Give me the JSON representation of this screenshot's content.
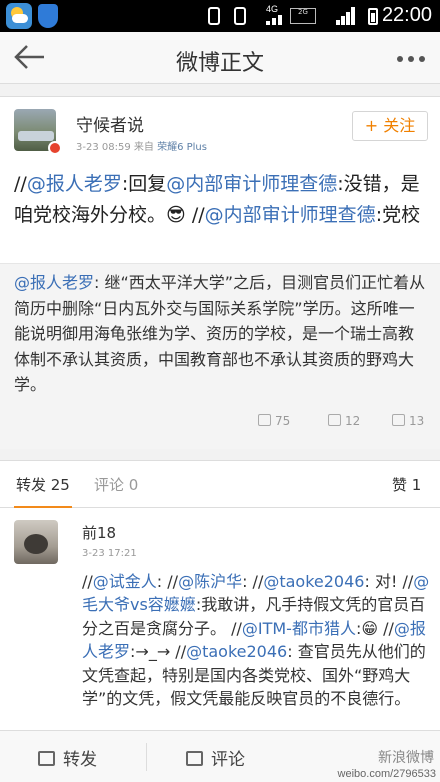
{
  "status_bar": {
    "network_label": "4G",
    "sim_label": "2G",
    "time": "22:00"
  },
  "nav": {
    "title": "微博正文",
    "back_icon": "arrow-left-icon",
    "more_icon": "more-dots-icon"
  },
  "post": {
    "username": "守候者说",
    "time": "3-23 08:59",
    "source_prefix": "来自",
    "source": "荣耀6 Plus",
    "follow_label": "+ 关注",
    "text_segments": [
      {
        "t": "//",
        "link": false
      },
      {
        "t": "@报人老罗",
        "link": true
      },
      {
        "t": ":回复",
        "link": false
      },
      {
        "t": "@内部审计师理查德",
        "link": true
      },
      {
        "t": ":没错，是咱党校海外分校。",
        "link": false
      },
      {
        "t": "😎",
        "link": false
      },
      {
        "t": " //",
        "link": false
      },
      {
        "t": "@内部审计师理查德",
        "link": true
      },
      {
        "t": ":党校",
        "link": false
      }
    ]
  },
  "repost": {
    "text_segments": [
      {
        "t": "@报人老罗",
        "link": true
      },
      {
        "t": ": 继“西太平洋大学”之后，目测官员们正忙着从简历中删除“日内瓦外交与国际关系学院”学历。这所唯一能说明御用海龟张维为学、资历的学校，是一个瑞士高教体制不承认其资质，中国教育部也不承认其资质的野鸡大学。",
        "link": false
      }
    ],
    "reposts": "75",
    "comments": "12",
    "likes": "13"
  },
  "tabs": {
    "repost_label": "转发 25",
    "comment_label": "评论 0",
    "like_label": "赞 1"
  },
  "comment": {
    "username": "前18",
    "time": "3-23 17:21",
    "text_segments": [
      {
        "t": "//",
        "link": false
      },
      {
        "t": "@试金人",
        "link": true
      },
      {
        "t": ": //",
        "link": false
      },
      {
        "t": "@陈沪华",
        "link": true
      },
      {
        "t": ": //",
        "link": false
      },
      {
        "t": "@taoke2046",
        "link": true
      },
      {
        "t": ": 对! //",
        "link": false
      },
      {
        "t": "@毛大爷vs容嬷嬷",
        "link": true
      },
      {
        "t": ":我敢讲，凡手持假文凭的官员百分之百是贪腐分子。 //",
        "link": false
      },
      {
        "t": "@ITM-都市猎人",
        "link": true
      },
      {
        "t": ":😁 //",
        "link": false
      },
      {
        "t": "@报人老罗",
        "link": true
      },
      {
        "t": ":→_→ //",
        "link": false
      },
      {
        "t": "@taoke2046",
        "link": true
      },
      {
        "t": ": 查官员先从他们的文凭查起，特别是国内各类党校、国外“野鸡大学”的文凭，假文凭最能反映官员的不良德行。",
        "link": false
      }
    ]
  },
  "bottom_bar": {
    "repost_label": "转发",
    "comment_label": "评论",
    "watermark": "weibo.com/2796533",
    "watermark_top": "新浪微博"
  },
  "colors": {
    "link": "#3b6fb6",
    "follow": "#f08000",
    "tab_underline": "#f28a1a"
  }
}
